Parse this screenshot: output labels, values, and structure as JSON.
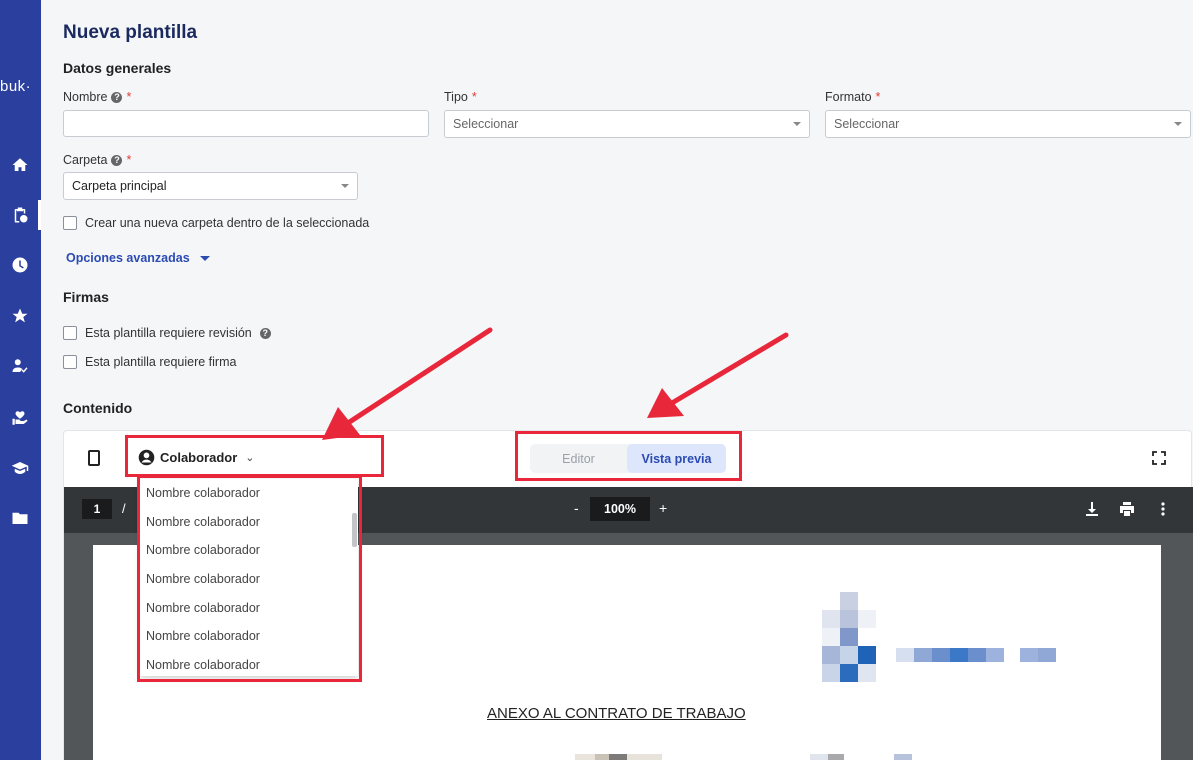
{
  "sidebar": {
    "logo": "buk·",
    "items": [
      "home-icon",
      "clipboard-icon",
      "clock-icon",
      "star-icon",
      "user-check-icon",
      "hand-heart-icon",
      "graduation-icon",
      "folder-icon"
    ]
  },
  "page": {
    "title": "Nueva plantilla"
  },
  "general": {
    "heading": "Datos generales",
    "name_label": "Nombre",
    "name_value": "",
    "type_label": "Tipo",
    "type_placeholder": "Seleccionar",
    "format_label": "Formato",
    "format_placeholder": "Seleccionar",
    "folder_label": "Carpeta",
    "folder_value": "Carpeta principal",
    "new_folder_checkbox": "Crear una nueva carpeta dentro de la seleccionada",
    "advanced_options": "Opciones avanzadas"
  },
  "signatures": {
    "heading": "Firmas",
    "review_checkbox": "Esta plantilla requiere revisión",
    "signature_checkbox": "Esta plantilla requiere firma"
  },
  "content": {
    "heading": "Contenido",
    "collaborator_button": "Colaborador",
    "tab_editor": "Editor",
    "tab_preview": "Vista previa",
    "active_tab": "Vista previa",
    "dropdown_items": [
      "Nombre colaborador",
      "Nombre colaborador",
      "Nombre colaborador",
      "Nombre colaborador",
      "Nombre colaborador",
      "Nombre colaborador",
      "Nombre colaborador"
    ]
  },
  "pdf_viewer": {
    "page_number": "1",
    "page_separator": "/",
    "zoom_minus": "-",
    "zoom": "100%",
    "zoom_plus": "+",
    "document_title": "ANEXO AL CONTRATO DE TRABAJO"
  },
  "colors": {
    "sidebar": "#2a3f9e",
    "accent": "#2b4bb3",
    "highlight": "#e8283a",
    "viewer_toolbar": "#323639"
  }
}
